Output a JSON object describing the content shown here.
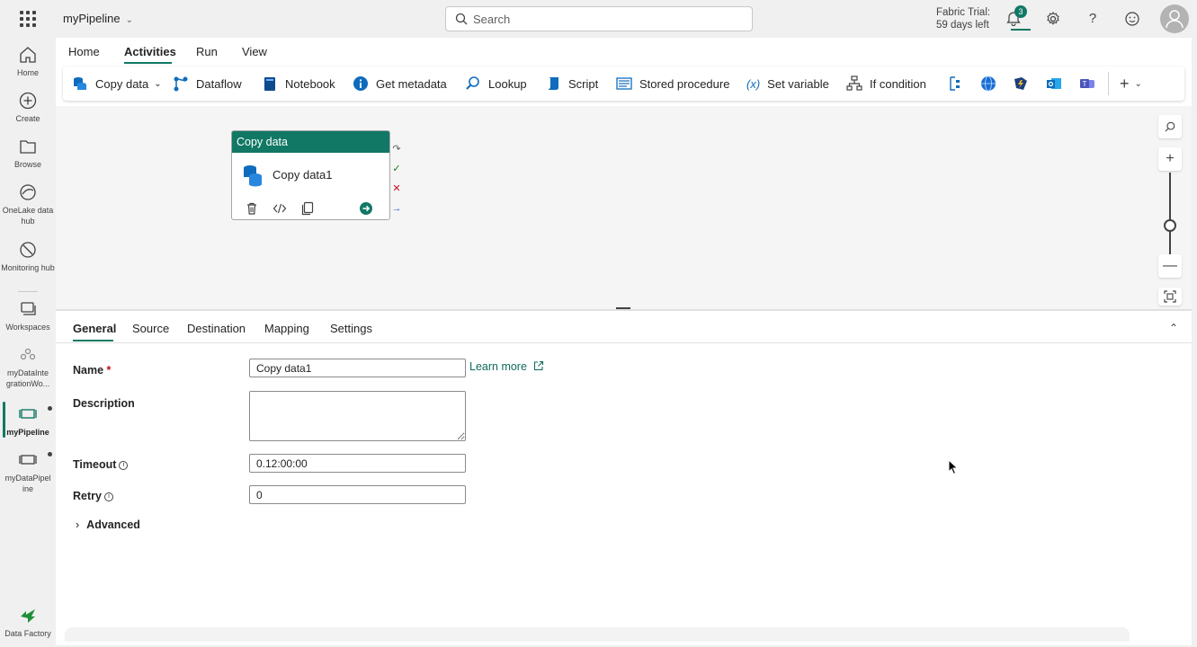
{
  "topbar": {
    "app_name": "myPipeline",
    "search_placeholder": "Search",
    "trial_line1": "Fabric Trial:",
    "trial_line2": "59 days left",
    "notification_count": "3"
  },
  "rail": {
    "items": [
      {
        "label": "Home",
        "icon": "home-icon"
      },
      {
        "label": "Create",
        "icon": "plus-circle-icon"
      },
      {
        "label": "Browse",
        "icon": "folder-icon"
      },
      {
        "label": "OneLake data hub",
        "icon": "onelake-icon"
      },
      {
        "label": "Monitoring hub",
        "icon": "monitor-icon"
      },
      {
        "label": "Workspaces",
        "icon": "workspaces-icon"
      },
      {
        "label": "myDataInte grationWo...",
        "icon": "workspace-group-icon"
      },
      {
        "label": "myPipeline",
        "icon": "pipeline-icon"
      },
      {
        "label": "myDataPipel ine",
        "icon": "pipeline-icon"
      }
    ],
    "footer_label": "Data Factory"
  },
  "ribbon": {
    "tabs": [
      "Home",
      "Activities",
      "Run",
      "View"
    ],
    "active_tab": "Activities",
    "activities": [
      {
        "label": "Copy data",
        "icon": "copy-data-icon"
      },
      {
        "label": "Dataflow",
        "icon": "dataflow-icon"
      },
      {
        "label": "Notebook",
        "icon": "notebook-icon"
      },
      {
        "label": "Get metadata",
        "icon": "info-icon"
      },
      {
        "label": "Lookup",
        "icon": "lookup-icon"
      },
      {
        "label": "Script",
        "icon": "script-icon"
      },
      {
        "label": "Stored procedure",
        "icon": "stored-procedure-icon"
      },
      {
        "label": "Set variable",
        "icon": "variable-icon"
      },
      {
        "label": "If condition",
        "icon": "if-condition-icon"
      }
    ]
  },
  "canvas": {
    "activity": {
      "header": "Copy data",
      "name": "Copy data1"
    }
  },
  "properties": {
    "tabs": [
      "General",
      "Source",
      "Destination",
      "Mapping",
      "Settings"
    ],
    "active_tab": "General",
    "name_label": "Name",
    "name_required_mark": "*",
    "name_value": "Copy data1",
    "learn_more": "Learn more",
    "description_label": "Description",
    "description_value": "",
    "timeout_label": "Timeout",
    "timeout_value": "0.12:00:00",
    "retry_label": "Retry",
    "retry_value": "0",
    "advanced_label": "Advanced"
  },
  "colors": {
    "accent": "#117865",
    "link": "#0f6b5c",
    "required": "#c50f1f"
  }
}
